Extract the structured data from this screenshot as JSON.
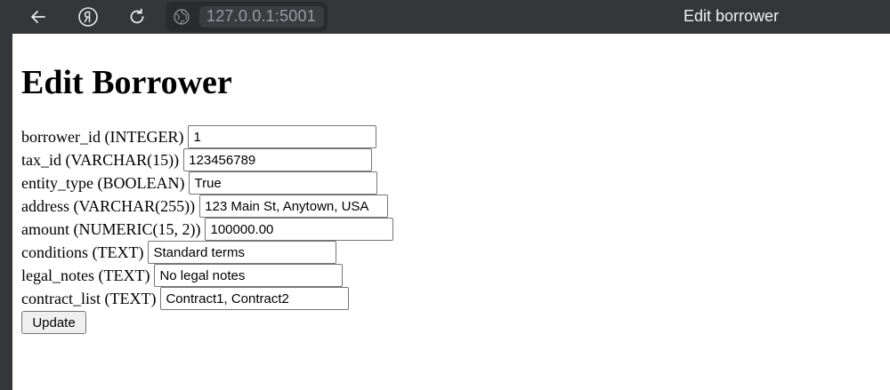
{
  "browser": {
    "url": "127.0.0.1:5001",
    "tab_title": "Edit borrower",
    "icons": [
      "back-arrow-icon",
      "yandex-icon",
      "reload-icon",
      "globe-icon"
    ]
  },
  "page": {
    "heading": "Edit Borrower",
    "fields": [
      {
        "label": "borrower_id (INTEGER)",
        "value": "1"
      },
      {
        "label": "tax_id (VARCHAR(15))",
        "value": "123456789"
      },
      {
        "label": "entity_type (BOOLEAN)",
        "value": "True"
      },
      {
        "label": "address (VARCHAR(255))",
        "value": "123 Main St, Anytown, USA"
      },
      {
        "label": "amount (NUMERIC(15, 2))",
        "value": "100000.00"
      },
      {
        "label": "conditions (TEXT)",
        "value": "Standard terms"
      },
      {
        "label": "legal_notes (TEXT)",
        "value": "No legal notes"
      },
      {
        "label": "contract_list (TEXT)",
        "value": "Contract1, Contract2"
      }
    ],
    "submit_label": "Update"
  }
}
